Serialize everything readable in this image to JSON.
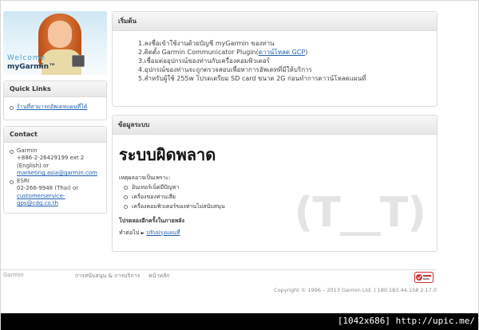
{
  "sidebar": {
    "welcome": "Welcome",
    "brand": "myGarmin™",
    "quick_links": {
      "title": "Quick Links",
      "items": [
        "ร้านที่สามารถอัพเดทแผนที่ได้"
      ]
    },
    "contact": {
      "title": "Contact",
      "garmin_label": "Garmin",
      "garmin_phone": "+886-2-26429199 ext 2",
      "garmin_lang": "(English) or",
      "garmin_email": "marketing.asia@garmin.com",
      "esri_label": "ESRI",
      "esri_phone": "02-266-9948 (Thai) or",
      "esri_email_1": "customerservice-",
      "esri_email_2": "gps@cdg.co.th"
    }
  },
  "start": {
    "title": "เริ่มต้น",
    "steps": [
      "1.ลงชื่อเข้าใช้งานด้วยบัญชี myGarmin ของท่าน",
      "2.ติดตั้ง Garmin Communicator Plugin(",
      "3.เชื่อมต่ออุปกรณ์ของท่านกับเครื่องคอมพิวเตอร์",
      "4.อุปกรณ์ของท่านจะถูกตรวจสอบเพื่อหาการอัพเดทที่มีให้บริการ",
      "5.สำหรับผู้ใช้ 255w โปรดเตรียม SD card ขนาด 2G ก่อนทำการดาวน์โหลดแผนที่"
    ],
    "gcp_link": "ดาวน์โหลด GCP",
    "gcp_close": ")"
  },
  "system": {
    "title": "ข้อมูลระบบ",
    "error_heading": "ระบบผิดพลาด",
    "reason_label": "เหตุผลอาจเป็นเพราะ:",
    "reasons": [
      "อินเทอร์เน็ตมีปัญหา",
      "เครื่องของท่านเสีย",
      "เครื่องคอมพิวเตอร์ของท่านไม่สนับสนุน"
    ],
    "retry_label": "โปรดลองอีกครั้งในภายหลัง",
    "next_label": "ทำต่อไป",
    "next_arrow": "►",
    "next_link": "ปรับปรุงแผนที่",
    "emoticon": "(T__T)"
  },
  "footer": {
    "garmin": "Garmin",
    "support_link": "การสนับสนุน & การบริการ",
    "home_link": "หน้าหลัก",
    "copyright": "Copyright © 1996 – 2013 Garmin Ltd. | 180.183.44.158 2.17.0"
  },
  "caption": "[1042x686] http://upic.me/"
}
